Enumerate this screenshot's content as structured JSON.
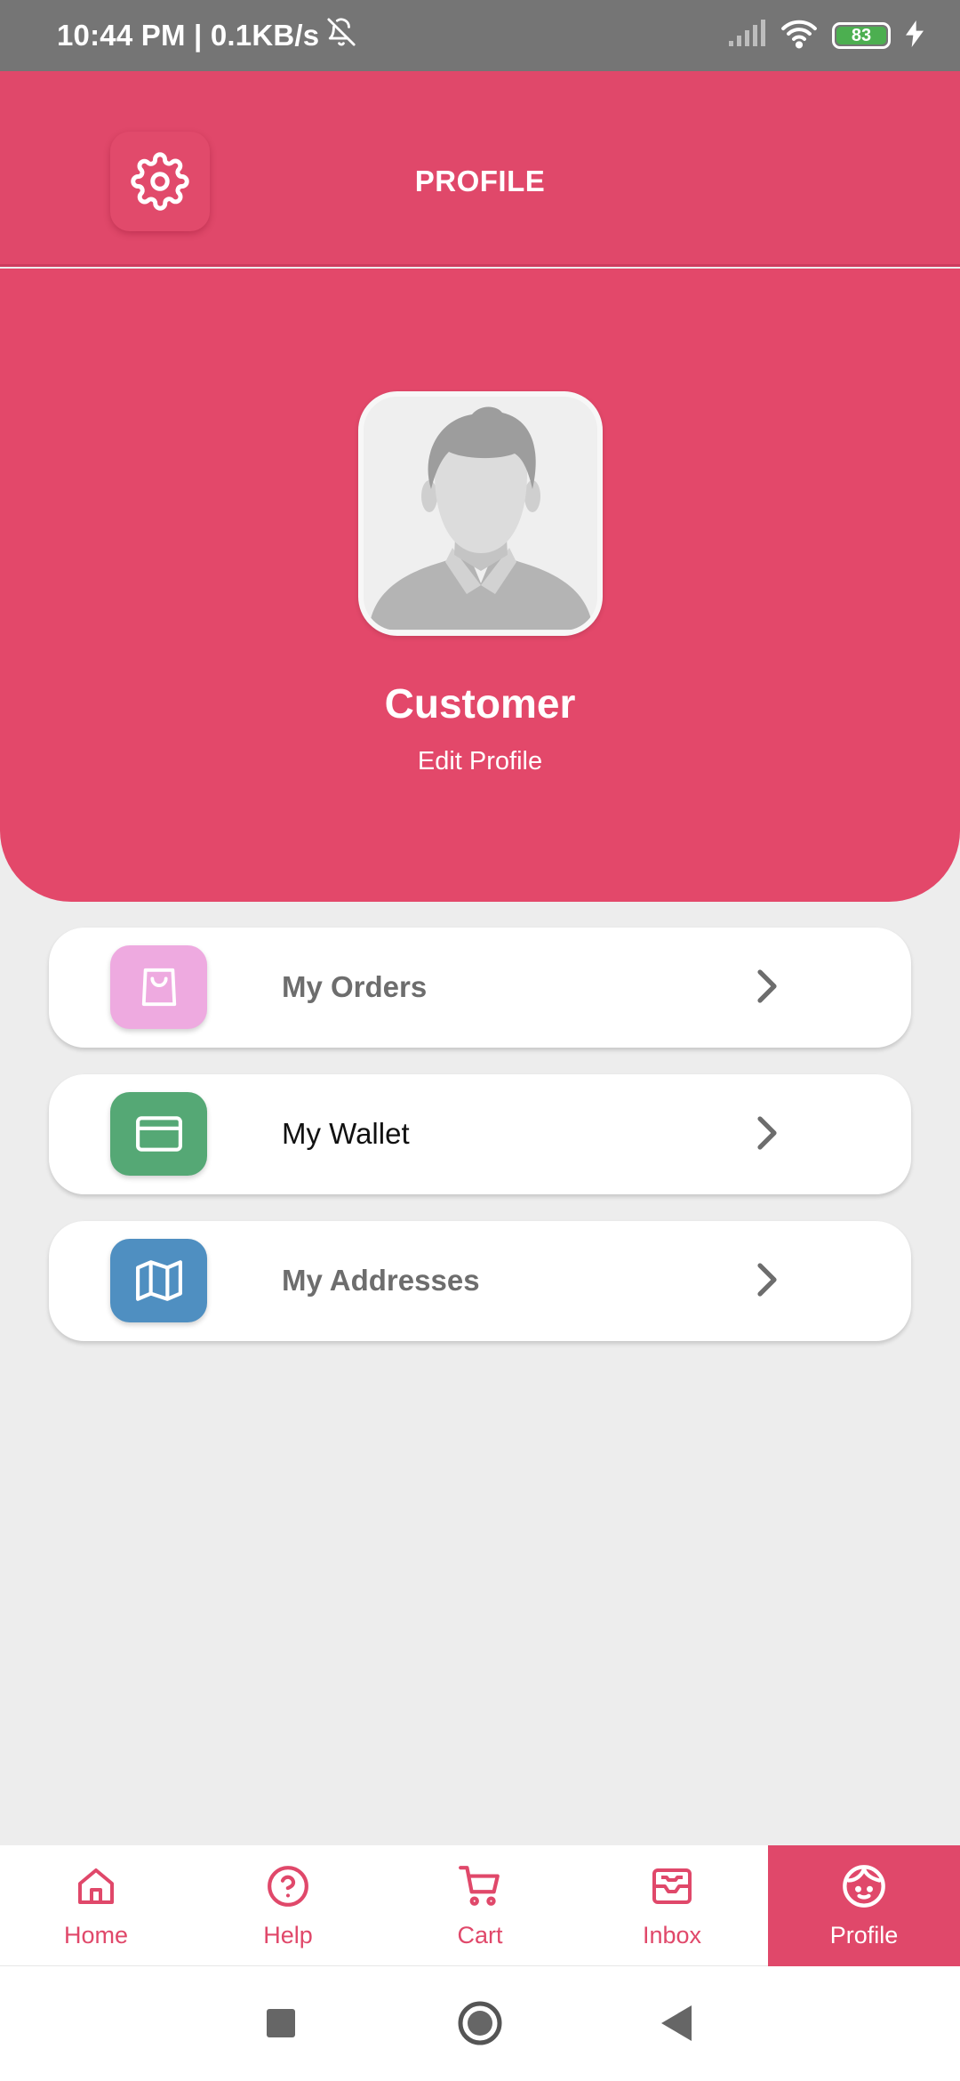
{
  "status_bar": {
    "time_speed": "10:44 PM | 0.1KB/s",
    "battery_level": "83"
  },
  "header": {
    "title": "PROFILE"
  },
  "profile": {
    "name": "Customer",
    "edit_label": "Edit Profile"
  },
  "menu": {
    "items": [
      {
        "label": "My Orders",
        "icon": "shopping-bag-icon",
        "color": "#eeaae0"
      },
      {
        "label": "My Wallet",
        "icon": "credit-card-icon",
        "color": "#55a875"
      },
      {
        "label": "My Addresses",
        "icon": "map-icon",
        "color": "#4f8fc1"
      }
    ]
  },
  "bottom_nav": {
    "items": [
      {
        "label": "Home",
        "icon": "home-icon"
      },
      {
        "label": "Help",
        "icon": "help-circle-icon"
      },
      {
        "label": "Cart",
        "icon": "cart-icon"
      },
      {
        "label": "Inbox",
        "icon": "inbox-icon"
      },
      {
        "label": "Profile",
        "icon": "profile-face-icon",
        "active": true
      }
    ]
  },
  "colors": {
    "brand": "#e0486a",
    "background": "#ededed",
    "status_bar": "#757575"
  }
}
